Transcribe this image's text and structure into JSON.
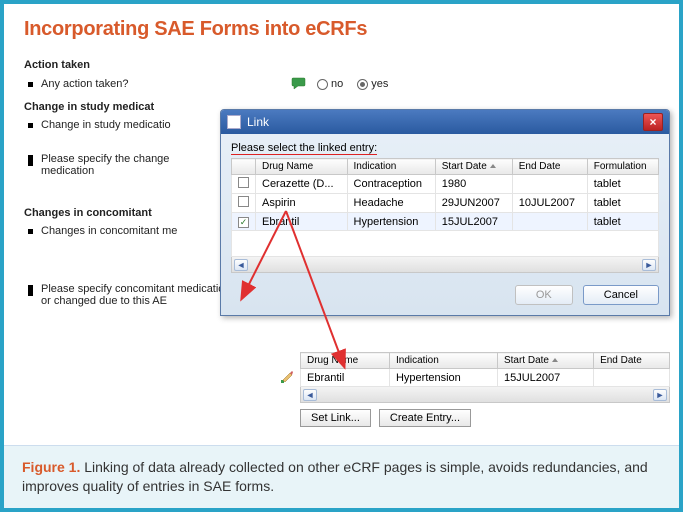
{
  "title": "Incorporating SAE Forms into eCRFs",
  "form": {
    "section_action": "Action taken",
    "q_any_action": "Any action taken?",
    "radio_no": "no",
    "radio_yes": "yes",
    "section_change_med": "Change in study medicat",
    "q_change_med": "Change in study medicatio",
    "q_specify_change": "Please specify the change\nmedication",
    "section_changes_con": "Changes in concomitant",
    "q_changes_con": "Changes in concomitant me",
    "q_specify_con": "Please specify concomitant medication, added\nor changed due to this AE"
  },
  "dialog": {
    "title": "Link",
    "prompt": "Please select the linked entry:",
    "cols": {
      "drug": "Drug Name",
      "indication": "Indication",
      "start": "Start Date",
      "end": "End Date",
      "formulation": "Formulation"
    },
    "rows": [
      {
        "checked": false,
        "drug": "Cerazette (D...",
        "indication": "Contraception",
        "start": "1980",
        "end": "",
        "formulation": "tablet"
      },
      {
        "checked": false,
        "drug": "Aspirin",
        "indication": "Headache",
        "start": "29JUN2007",
        "end": "10JUL2007",
        "formulation": "tablet"
      },
      {
        "checked": true,
        "drug": "Ebrantil",
        "indication": "Hypertension",
        "start": "15JUL2007",
        "end": "",
        "formulation": "tablet"
      }
    ],
    "ok": "OK",
    "cancel": "Cancel"
  },
  "detail": {
    "cols": {
      "drug": "Drug Name",
      "indication": "Indication",
      "start": "Start Date",
      "end": "End Date"
    },
    "row": {
      "drug": "Ebrantil",
      "indication": "Hypertension",
      "start": "15JUL2007",
      "end": ""
    },
    "set_link": "Set Link...",
    "create_entry": "Create Entry..."
  },
  "caption": {
    "label": "Figure 1.",
    "text": " Linking of data already collected on other eCRF pages is simple, avoids redundancies, and improves quality of entries in SAE forms."
  },
  "icons": {
    "speech": "speech-bubble-icon",
    "edit": "pencil-icon"
  }
}
